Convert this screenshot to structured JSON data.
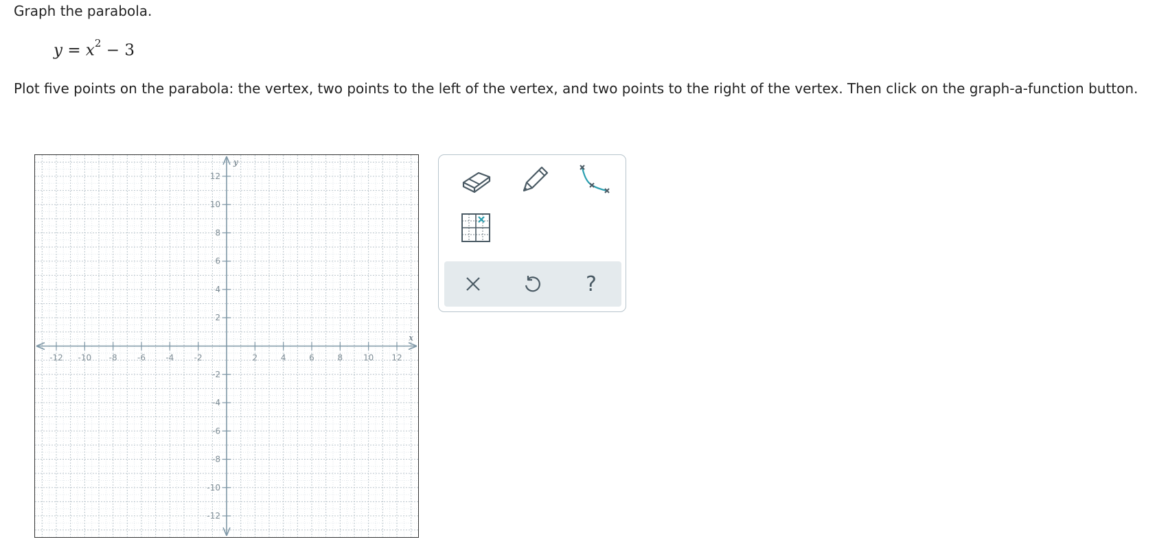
{
  "problem": {
    "prompt": "Graph the parabola.",
    "equation": {
      "lhs": "y",
      "equals": "=",
      "var": "x",
      "exponent": "2",
      "rest": "− 3"
    },
    "instructions": "Plot five points on the parabola: the vertex, two points to the left of the vertex, and two points to the right of the vertex. Then click on the graph-a-function button."
  },
  "graph": {
    "x_axis_label": "x",
    "y_axis_label": "y",
    "x_range": [
      -13.5,
      13.5
    ],
    "y_range": [
      -13.5,
      13.5
    ],
    "minor_grid_step": 1,
    "x_tick_labels": [
      "-12",
      "-10",
      "-8",
      "-6",
      "-4",
      "-2",
      "2",
      "4",
      "6",
      "8",
      "10",
      "12"
    ],
    "y_tick_labels": [
      "12",
      "10",
      "8",
      "6",
      "4",
      "2",
      "-2",
      "-4",
      "-6",
      "-8",
      "-10",
      "-12"
    ],
    "grid": true,
    "colors": {
      "grid": "#b9c4cb",
      "axis": "#7e97a6",
      "label": "#7d8c95"
    }
  },
  "tools": {
    "eraser": "eraser-icon",
    "pencil": "pencil-icon",
    "graph_function": "graph-a-function-icon",
    "point_grid": "plot-point-grid-icon",
    "clear": "close-icon",
    "undo": "undo-icon",
    "help": "help-icon",
    "help_glyph": "?",
    "accent": "#2a9fb0",
    "icon_color": "#4a5a64"
  }
}
